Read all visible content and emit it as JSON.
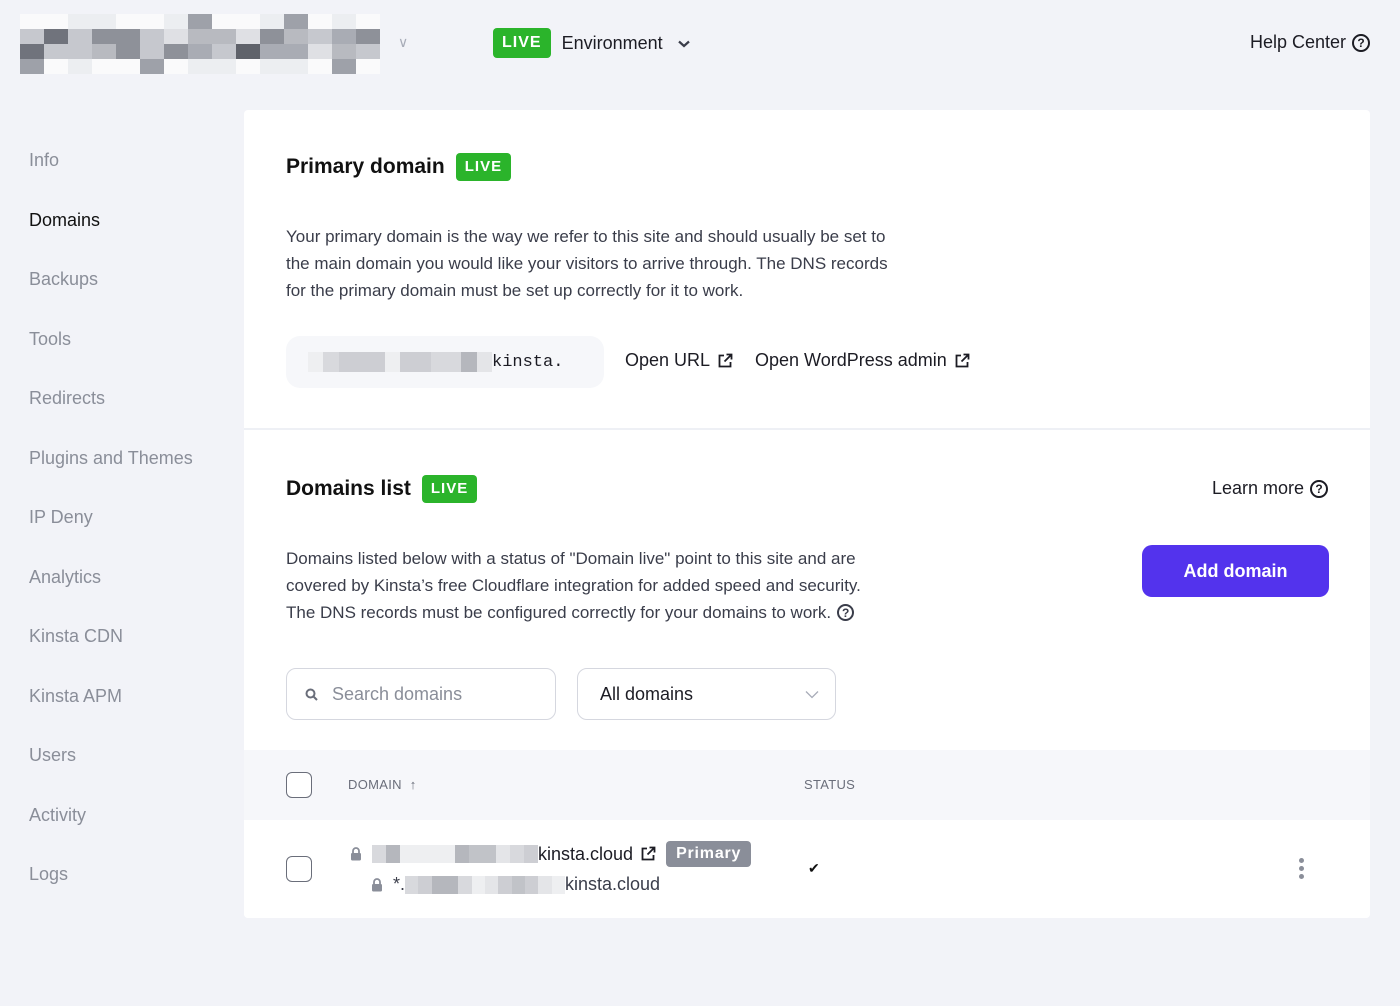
{
  "header": {
    "site_name_redacted": true,
    "environment": {
      "badge": "LIVE",
      "label": "Environment"
    },
    "help_center": "Help Center"
  },
  "sidebar": {
    "active": "Domains",
    "items": [
      {
        "label": "Info"
      },
      {
        "label": "Domains"
      },
      {
        "label": "Backups"
      },
      {
        "label": "Tools"
      },
      {
        "label": "Redirects"
      },
      {
        "label": "Plugins and Themes"
      },
      {
        "label": "IP Deny"
      },
      {
        "label": "Analytics"
      },
      {
        "label": "Kinsta CDN"
      },
      {
        "label": "Kinsta APM"
      },
      {
        "label": "Users"
      },
      {
        "label": "Activity"
      },
      {
        "label": "Logs"
      }
    ]
  },
  "primary_domain": {
    "title": "Primary domain",
    "badge": "LIVE",
    "description": "Your primary domain is the way we refer to this site and should usually be set to the main domain you would like your visitors to arrive through. The DNS records for the primary domain must be set up correctly for it to work.",
    "description_lines": [
      "Your primary domain is the way we refer to this site and should usually be set to",
      "the main domain you would like your visitors to arrive through. The DNS records",
      "for the primary domain must be set up correctly for it to work."
    ],
    "domain_visible_suffix": "kinsta.",
    "open_url": "Open URL",
    "open_wp_admin": "Open WordPress admin"
  },
  "domains_list": {
    "title": "Domains list",
    "badge": "LIVE",
    "learn_more": "Learn more",
    "description_lines": [
      "Domains listed below with a status of \"Domain live\" point to this site and are",
      "covered by Kinsta’s free Cloudflare integration for added speed and security.",
      "The DNS records must be configured correctly for your domains to work."
    ],
    "add_domain": "Add domain",
    "search_placeholder": "Search domains",
    "filter_selected": "All domains",
    "columns": {
      "domain": "DOMAIN",
      "domain_sort": "↑",
      "status": "STATUS"
    },
    "rows": [
      {
        "domain_suffix": "kinsta.cloud",
        "wildcard_prefix": "*.",
        "wildcard_suffix": "kinsta.cloud",
        "badge": "Primary",
        "status_icon": "✔"
      }
    ]
  },
  "colors": {
    "live_green": "#2bb42b",
    "primary_button": "#5333ed",
    "primary_badge": "#8a8e99",
    "background": "#f2f3f8"
  }
}
